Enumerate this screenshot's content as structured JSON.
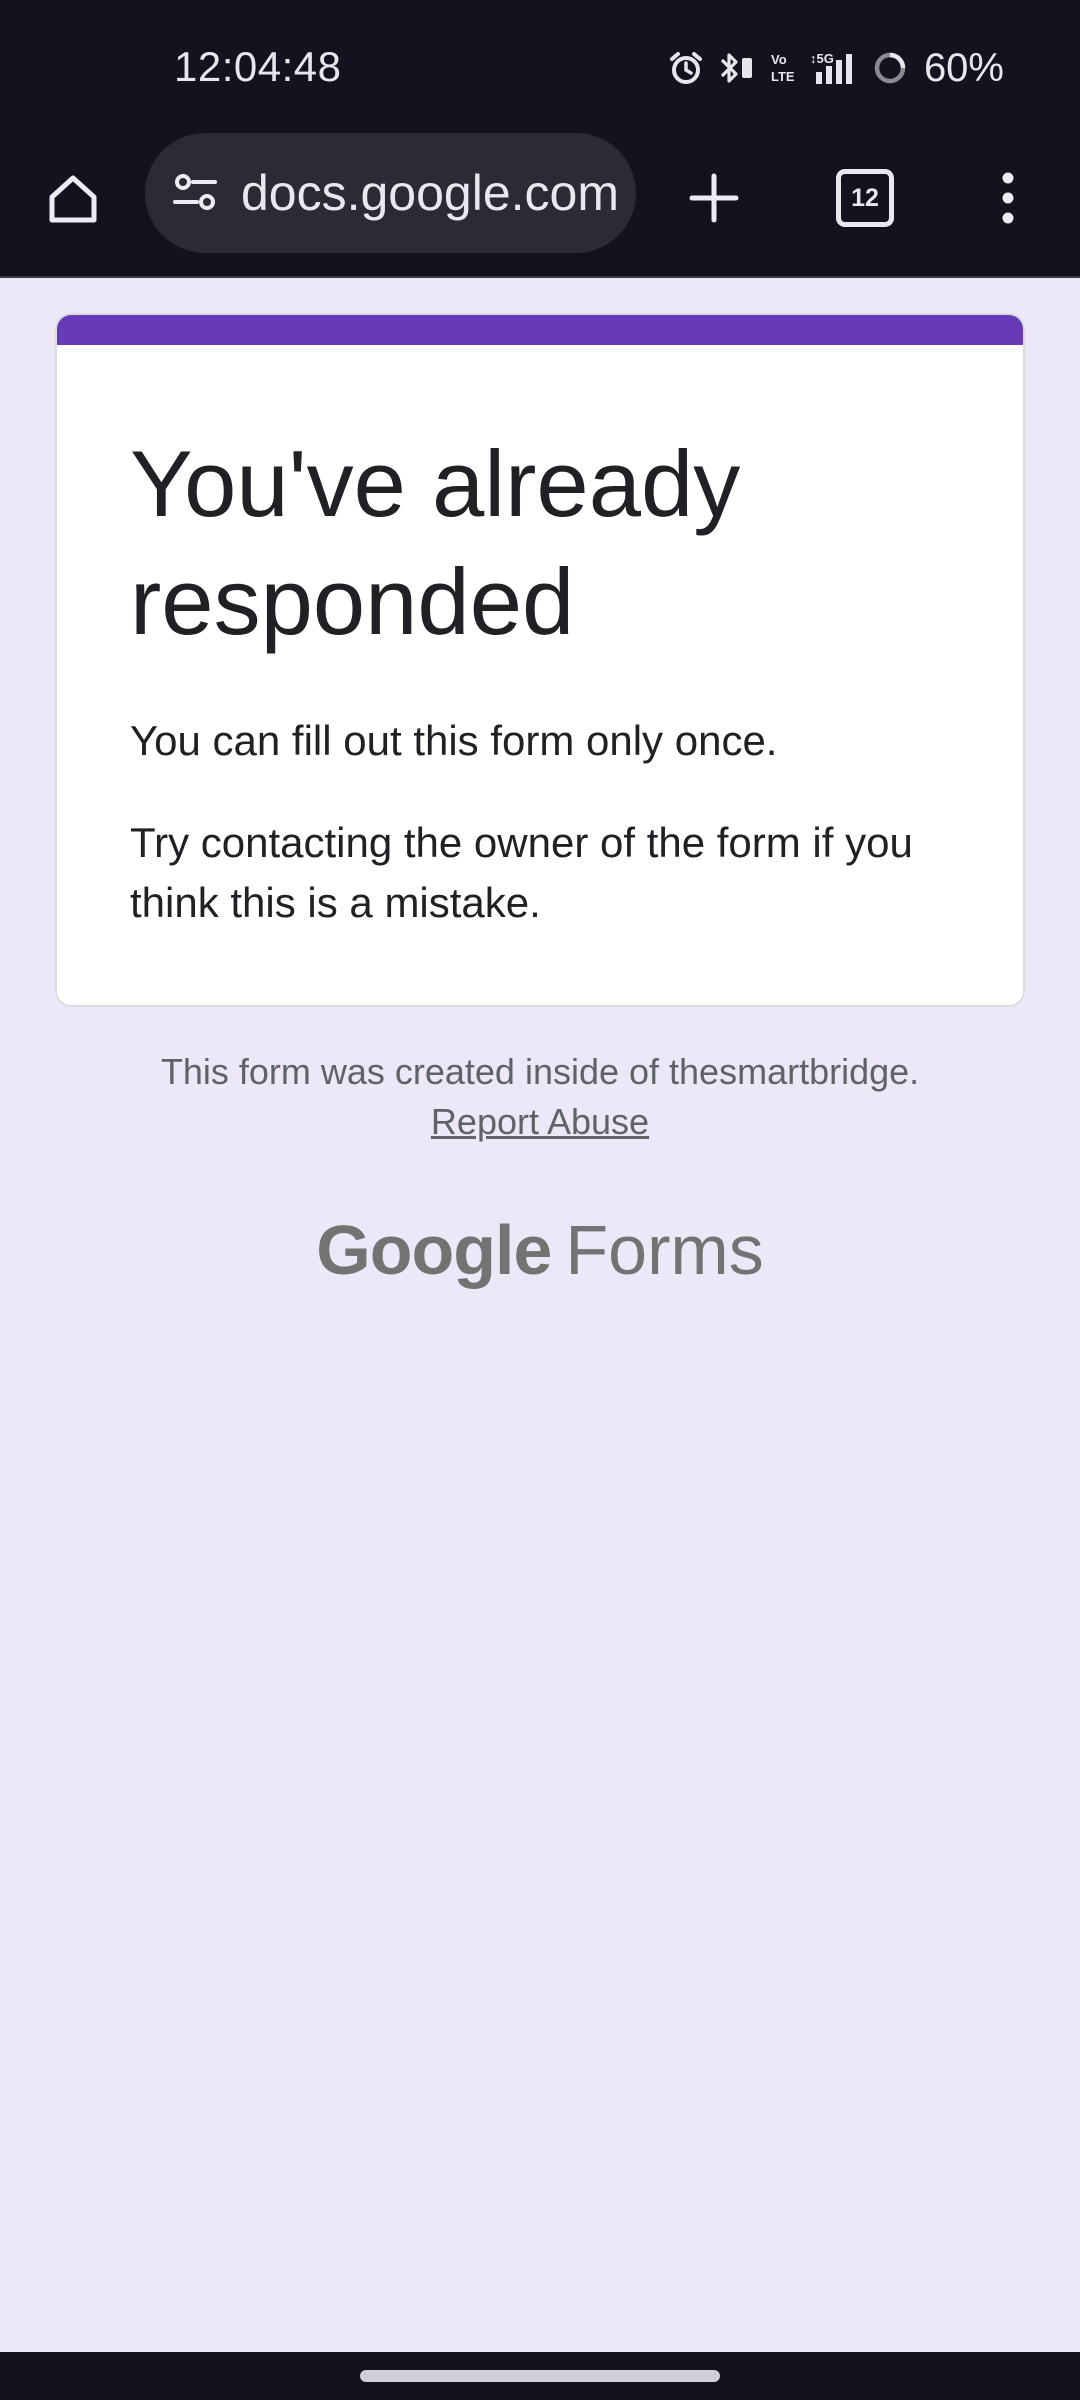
{
  "status_bar": {
    "time": "12:04:48",
    "icons": [
      "alarm-icon",
      "bluetooth-icon",
      "volte-icon",
      "5g-signal-icon",
      "battery-saver-icon"
    ],
    "battery_percent": "60%"
  },
  "browser": {
    "url_display": "docs.google.com",
    "tab_count": "12",
    "icons": [
      "home-icon",
      "site-info-icon",
      "plus-icon",
      "tab-switcher-icon",
      "more-vert-icon"
    ]
  },
  "card": {
    "accent_color": "#673ab7",
    "title": "You've already responded",
    "message_1": "You can fill out this form only once.",
    "message_2": "Try contacting the owner of the form if you think this is a mistake."
  },
  "footer": {
    "note": "This form was created inside of thesmartbridge.",
    "report_link": "Report Abuse",
    "brand_google": "Google",
    "brand_forms": "Forms"
  },
  "colors": {
    "page_background": "#ede8f7",
    "chrome_dark": "#13131f",
    "url_pill": "#2b2b36"
  }
}
